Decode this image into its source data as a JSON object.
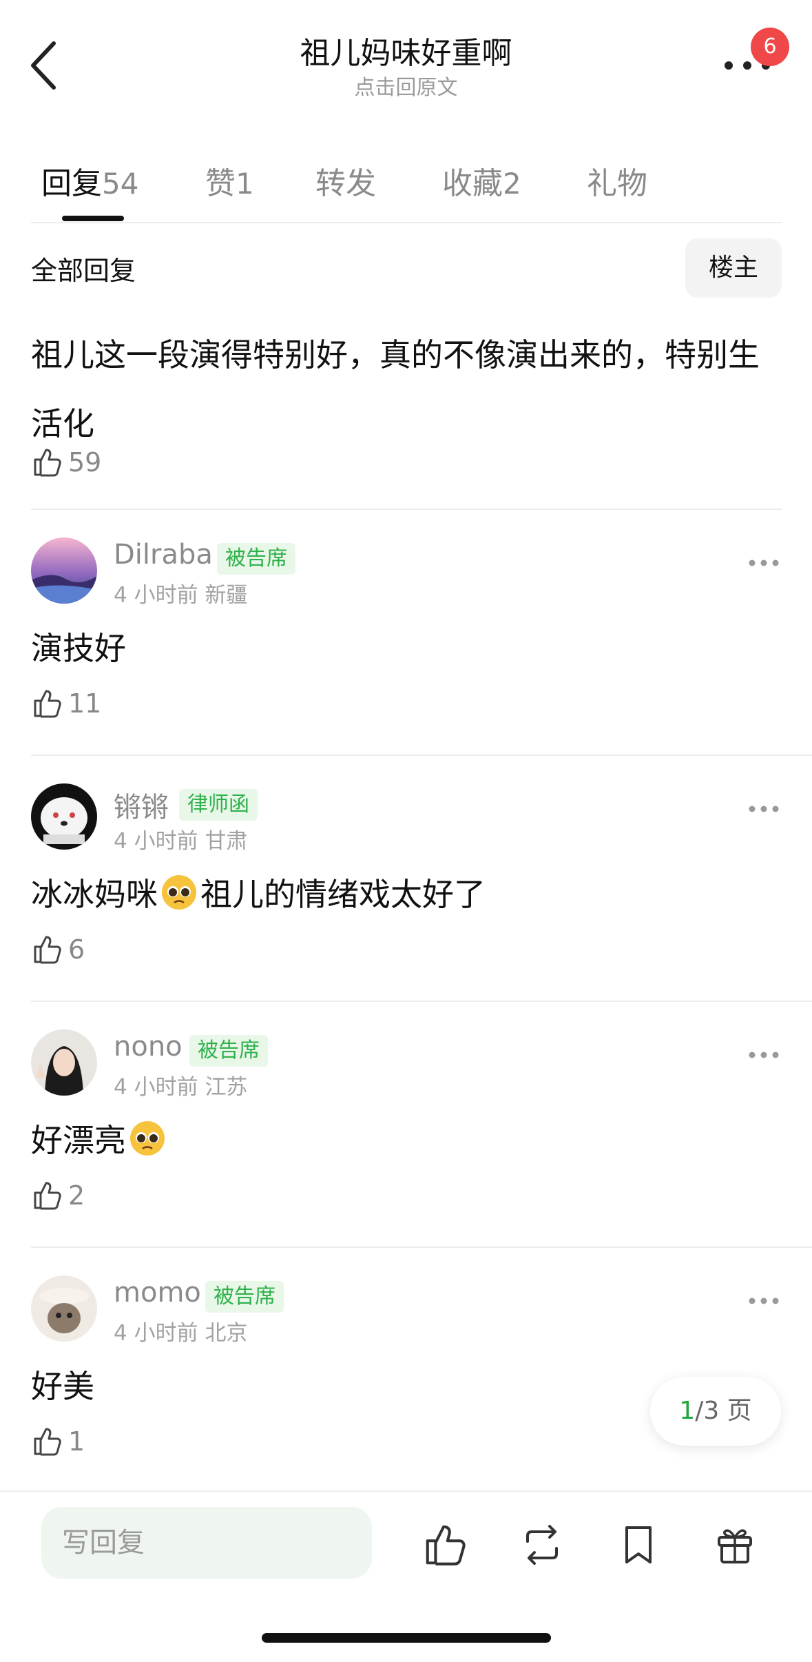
{
  "header": {
    "title": "祖儿妈味好重啊",
    "subtitle": "点击回原文",
    "badge_count": "6"
  },
  "tabs": [
    {
      "label": "回复",
      "count": "54"
    },
    {
      "label": "赞",
      "count": "1"
    },
    {
      "label": "转发",
      "count": ""
    },
    {
      "label": "收藏",
      "count": "2"
    },
    {
      "label": "礼物",
      "count": ""
    }
  ],
  "subheader": {
    "all_replies": "全部回复",
    "owner_button": "楼主"
  },
  "post": {
    "text": "祖儿这一段演得特别好，真的不像演出来的，特别生活化",
    "likes": "59"
  },
  "comments": [
    {
      "name": "Dilraba",
      "tag": "被告席",
      "time": "4 小时前",
      "location": "新疆",
      "text": "演技好",
      "emoji_after_text": "",
      "likes": "11"
    },
    {
      "name": "锵锵",
      "tag": "律师函",
      "time": "4 小时前",
      "location": "甘肃",
      "text_before": "冰冰妈咪",
      "text_after": "祖儿的情绪戏太好了",
      "likes": "6"
    },
    {
      "name": "nono",
      "tag": "被告席",
      "time": "4 小时前",
      "location": "江苏",
      "text": "好漂亮",
      "likes": "2"
    },
    {
      "name": "momo",
      "tag": "被告席",
      "time": "4 小时前",
      "location": "北京",
      "text": "好美",
      "likes": "1"
    }
  ],
  "pagination": {
    "current": "1",
    "rest": "/3 页"
  },
  "bottom_bar": {
    "reply_placeholder": "写回复"
  },
  "icons": {
    "back": "chevron-left-icon",
    "more": "more-dots-icon",
    "like": "thumbs-up-icon",
    "repost": "repost-icon",
    "bookmark": "bookmark-icon",
    "gift": "gift-icon",
    "emoji": "pleading-face-emoji"
  },
  "colors": {
    "accent_green": "#2fb14b",
    "tag_bg": "#e9f7e9",
    "badge_red": "#f04848"
  }
}
